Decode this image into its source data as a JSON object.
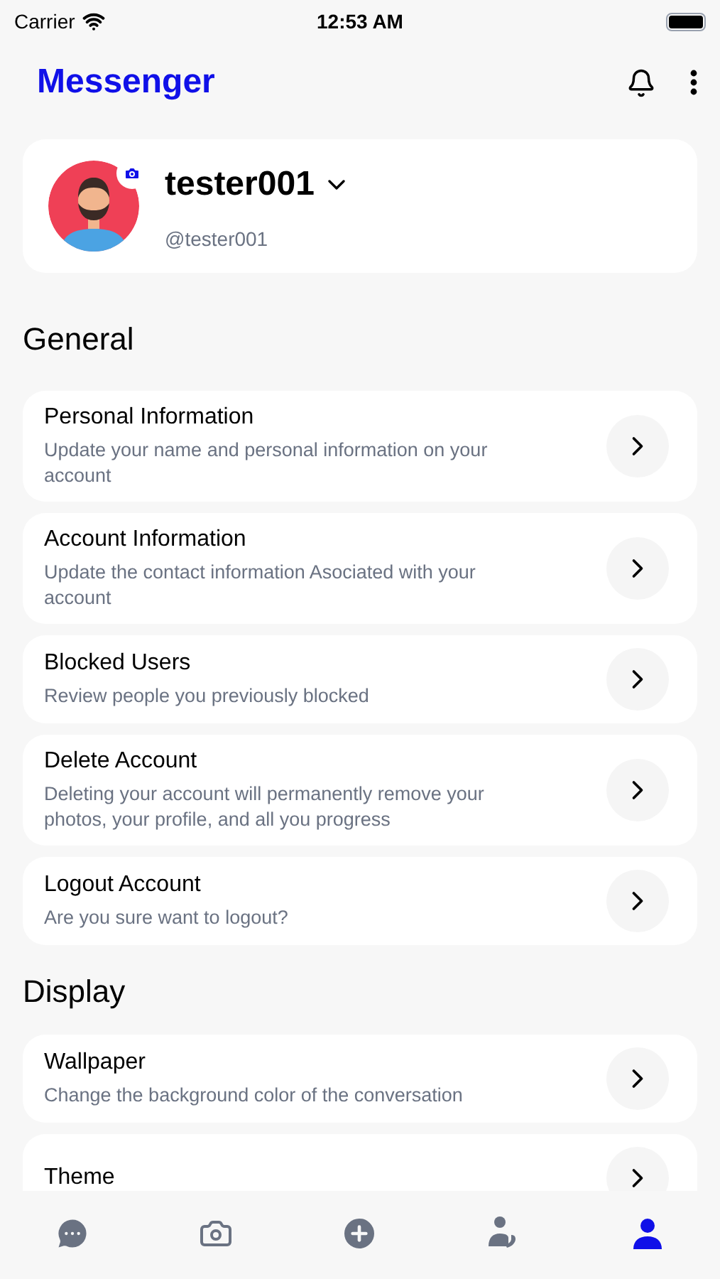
{
  "status_bar": {
    "carrier": "Carrier",
    "time": "12:53 AM"
  },
  "header": {
    "title": "Messenger"
  },
  "profile": {
    "name": "tester001",
    "handle": "@tester001"
  },
  "sections": [
    {
      "title": "General",
      "items": [
        {
          "title": "Personal Information",
          "description": "Update your name and personal information on your account"
        },
        {
          "title": "Account Information",
          "description": "Update the contact information Asociated with your account"
        },
        {
          "title": "Blocked Users",
          "description": "Review people you previously blocked"
        },
        {
          "title": "Delete Account",
          "description": "Deleting your account will permanently remove your photos, your profile, and all you progress"
        },
        {
          "title": "Logout Account",
          "description": "Are you sure want to logout?"
        }
      ]
    },
    {
      "title": "Display",
      "items": [
        {
          "title": "Wallpaper",
          "description": "Change the background color of the conversation"
        },
        {
          "title": "Theme"
        }
      ]
    }
  ],
  "tab_bar": [
    {
      "kind": "chats",
      "selected": false
    },
    {
      "kind": "camera",
      "selected": false
    },
    {
      "kind": "add",
      "selected": false
    },
    {
      "kind": "contacts",
      "selected": false
    },
    {
      "kind": "profile",
      "selected": true
    }
  ]
}
